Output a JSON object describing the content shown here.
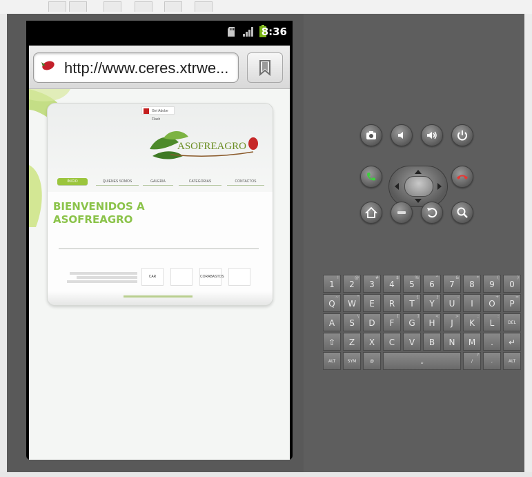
{
  "status": {
    "time": "8:36"
  },
  "browser": {
    "url": "http://www.ceres.xtrwe..."
  },
  "website": {
    "logo": "ASOFREAGRO",
    "flash_badge": "Get Adobe Flash",
    "nav": [
      "INICIO",
      "QUIENES SOMOS",
      "GALERIA",
      "CATEGORIAS",
      "CONTACTOS"
    ],
    "welcome_line1": "BIENVENIDOS A",
    "welcome_line2": "ASOFREAGRO",
    "partners": [
      "CAR",
      "",
      "CORABASTOS",
      ""
    ]
  },
  "keyboard": {
    "row1": [
      {
        "k": "1",
        "s": "!"
      },
      {
        "k": "2",
        "s": "@"
      },
      {
        "k": "3",
        "s": "#"
      },
      {
        "k": "4",
        "s": "$"
      },
      {
        "k": "5",
        "s": "%"
      },
      {
        "k": "6",
        "s": "^"
      },
      {
        "k": "7",
        "s": "&"
      },
      {
        "k": "8",
        "s": "*"
      },
      {
        "k": "9",
        "s": "("
      },
      {
        "k": "0",
        "s": ")"
      }
    ],
    "row2": [
      {
        "k": "Q",
        "s": "~"
      },
      {
        "k": "W",
        "s": "\""
      },
      {
        "k": "E",
        "s": ""
      },
      {
        "k": "R",
        "s": ""
      },
      {
        "k": "T",
        "s": "{"
      },
      {
        "k": "Y",
        "s": "}"
      },
      {
        "k": "U",
        "s": "-"
      },
      {
        "k": "I",
        "s": ""
      },
      {
        "k": "O",
        "s": "+"
      },
      {
        "k": "P",
        "s": "="
      }
    ],
    "row3": [
      {
        "k": "A",
        "s": ""
      },
      {
        "k": "S",
        "s": "\\"
      },
      {
        "k": "D",
        "s": ""
      },
      {
        "k": "F",
        "s": "["
      },
      {
        "k": "G",
        "s": "]"
      },
      {
        "k": "H",
        "s": "<"
      },
      {
        "k": "J",
        "s": ">"
      },
      {
        "k": "K",
        "s": ";"
      },
      {
        "k": "L",
        "s": ":"
      },
      {
        "k": "DEL",
        "s": ""
      }
    ],
    "row4": [
      {
        "k": "⇧",
        "s": ""
      },
      {
        "k": "Z",
        "s": ""
      },
      {
        "k": "X",
        "s": ""
      },
      {
        "k": "C",
        "s": ""
      },
      {
        "k": "V",
        "s": ""
      },
      {
        "k": "B",
        "s": ""
      },
      {
        "k": "N",
        "s": ""
      },
      {
        "k": "M",
        "s": ""
      },
      {
        "k": ".",
        "s": ""
      },
      {
        "k": "↵",
        "s": ""
      }
    ],
    "row5": [
      {
        "k": "ALT",
        "s": ""
      },
      {
        "k": "SYM",
        "s": ""
      },
      {
        "k": "@",
        "s": ""
      },
      {
        "k": "␣",
        "s": ""
      },
      {
        "k": "/",
        "s": "?"
      },
      {
        "k": ",",
        "s": ""
      },
      {
        "k": "ALT",
        "s": ""
      }
    ]
  },
  "colors": {
    "accent_green": "#8bc34a",
    "skin": "#5e5e5e"
  },
  "icons": [
    "sd-card-icon",
    "signal-icon",
    "battery-icon",
    "favicon-icon",
    "bookmark-icon",
    "camera-icon",
    "volume-down-icon",
    "volume-up-icon",
    "power-icon",
    "call-icon",
    "end-call-icon",
    "home-icon",
    "menu-icon",
    "back-icon",
    "search-icon"
  ]
}
